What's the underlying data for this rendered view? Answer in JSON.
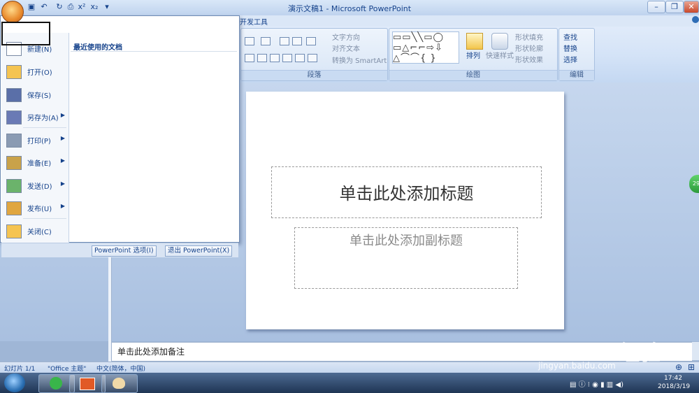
{
  "window": {
    "title": "演示文稿1 - Microsoft PowerPoint"
  },
  "ribbon": {
    "tabs": [
      "开发工具"
    ],
    "paragraph": {
      "label": "段落",
      "text_direction": "文字方向",
      "align_text": "对齐文本",
      "convert_smartart": "转换为 SmartArt"
    },
    "drawing": {
      "label": "绘图",
      "arrange": "排列",
      "quick_styles": "快速样式",
      "shape_fill": "形状填充",
      "shape_outline": "形状轮廓",
      "shape_effects": "形状效果"
    },
    "editing": {
      "label": "编辑",
      "find": "查找",
      "replace": "替换",
      "select": "选择"
    }
  },
  "office_menu": {
    "items": [
      {
        "label": "新建(N)",
        "icon": "new-document-icon",
        "submenu": false
      },
      {
        "label": "打开(O)",
        "icon": "open-folder-icon",
        "submenu": false
      },
      {
        "label": "保存(S)",
        "icon": "save-icon",
        "submenu": false
      },
      {
        "label": "另存为(A)",
        "icon": "save-as-icon",
        "submenu": true
      },
      {
        "label": "打印(P)",
        "icon": "print-icon",
        "submenu": true
      },
      {
        "label": "准备(E)",
        "icon": "prepare-icon",
        "submenu": true
      },
      {
        "label": "发送(D)",
        "icon": "send-icon",
        "submenu": true
      },
      {
        "label": "发布(U)",
        "icon": "publish-icon",
        "submenu": true
      },
      {
        "label": "关闭(C)",
        "icon": "close-folder-icon",
        "submenu": false
      }
    ],
    "recent_title": "最近使用的文档",
    "options_button": "PowerPoint 选项(I)",
    "exit_button": "退出 PowerPoint(X)"
  },
  "slide": {
    "title_placeholder": "单击此处添加标题",
    "subtitle_placeholder": "单击此处添加副标题"
  },
  "notes": {
    "placeholder": "单击此处添加备注"
  },
  "statusbar": {
    "slide_counter": "幻灯片 1/1",
    "theme": "\"Office 主题\"",
    "language": "中文(简体，中国)"
  },
  "taskbar": {
    "time": "17:42",
    "date": "2018/3/19"
  },
  "badge": {
    "text": "29"
  },
  "watermark": {
    "text": "Bai du 经验",
    "sub": "jingyan.baidu.com"
  }
}
